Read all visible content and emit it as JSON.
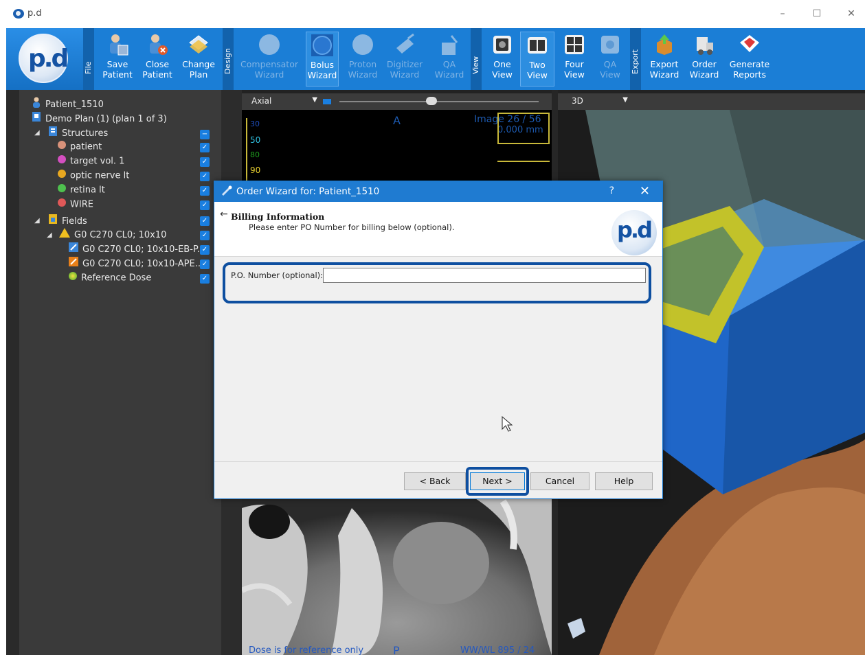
{
  "window": {
    "title": "p.d",
    "minimize": "–",
    "maximize": "☐",
    "close": "✕"
  },
  "ribbon": {
    "logo_text": "p.d",
    "groups": {
      "file": "File",
      "design": "Design",
      "view": "View",
      "export": "Export"
    },
    "buttons": {
      "save_patient": [
        "Save",
        "Patient"
      ],
      "close_patient": [
        "Close",
        "Patient"
      ],
      "change_plan": [
        "Change",
        "Plan"
      ],
      "compensator_wizard": [
        "Compensator",
        "Wizard"
      ],
      "bolus_wizard": [
        "Bolus",
        "Wizard"
      ],
      "proton_wizard": [
        "Proton",
        "Wizard"
      ],
      "digitizer_wizard": [
        "Digitizer",
        "Wizard"
      ],
      "qa_wizard": [
        "QA",
        "Wizard"
      ],
      "one_view": [
        "One",
        "View"
      ],
      "two_view": [
        "Two",
        "View"
      ],
      "four_view": [
        "Four",
        "View"
      ],
      "qa_view": [
        "QA",
        "View"
      ],
      "export_wizard": [
        "Export",
        "Wizard"
      ],
      "order_wizard": [
        "Order",
        "Wizard"
      ],
      "generate_reports": [
        "Generate",
        "Reports"
      ]
    }
  },
  "tree": {
    "patient": "Patient_1510",
    "plan": "Demo Plan (1) (plan 1 of 3)",
    "structures_label": "Structures",
    "structures": [
      {
        "label": "patient",
        "color": "#d9927a"
      },
      {
        "label": "target vol. 1",
        "color": "#d44fc0"
      },
      {
        "label": "optic nerve lt",
        "color": "#e8a820"
      },
      {
        "label": "retina lt",
        "color": "#4ec04e"
      },
      {
        "label": "WIRE",
        "color": "#e05858"
      }
    ],
    "fields_label": "Fields",
    "field_parent": "G0 C270 CL0; 10x10",
    "field_children": [
      "G0 C270 CL0; 10x10-EB-P...",
      "G0 C270 CL0; 10x10-APE..."
    ],
    "reference_dose": "Reference Dose",
    "check_mark": "✓",
    "partial_mark": "−"
  },
  "axial": {
    "view_select": "Axial",
    "orientation_top": "A",
    "orientation_bottom": "P",
    "image_label": "Image 26 / 56",
    "scale_label": "0.000 mm",
    "isodose_levels": [
      "30",
      "50",
      "80",
      "90"
    ],
    "footer_left": "Dose is for reference only",
    "footer_right": "WW/WL 895 / 24"
  },
  "view3d": {
    "view_select": "3D"
  },
  "dialog": {
    "title": "Order Wizard for: Patient_1510",
    "help_glyph": "?",
    "close_glyph": "✕",
    "back_arrow": "←",
    "heading": "Billing Information",
    "subheading": "Please enter PO Number for billing below (optional).",
    "logo_text": "p.d",
    "po_label": "P.O. Number (optional):",
    "po_value": "",
    "buttons": {
      "back": "< Back",
      "next": "Next >",
      "cancel": "Cancel",
      "help": "Help"
    }
  },
  "colors": {
    "ribbon": "#1b7ed6",
    "dialog_title": "#1f7bd1",
    "highlight": "#0e4fa0",
    "panel": "#3a3a3a"
  }
}
